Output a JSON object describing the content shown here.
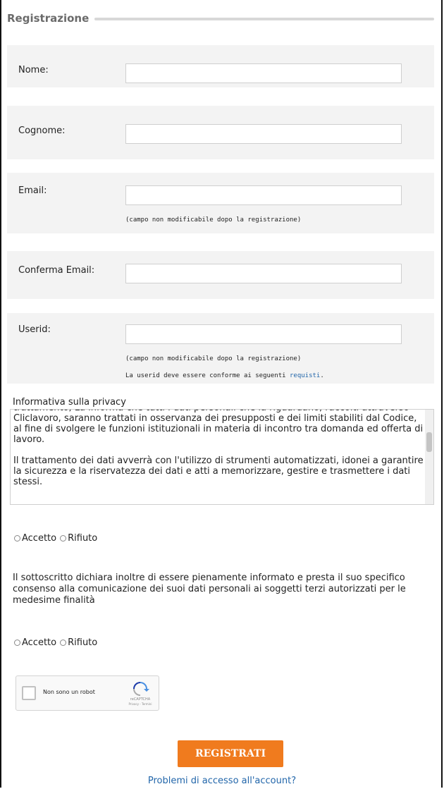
{
  "form": {
    "legend": "Registrazione",
    "fields": {
      "nome": {
        "label": "Nome:",
        "value": ""
      },
      "cognome": {
        "label": "Cognome:",
        "value": ""
      },
      "email": {
        "label": "Email:",
        "value": "",
        "hint": "(campo non modificabile dopo la registrazione)"
      },
      "conferma_email": {
        "label": "Conferma Email:",
        "value": ""
      },
      "userid": {
        "label": "Userid:",
        "value": "",
        "hint": "(campo non modificabile dopo la registrazione)",
        "rule_prefix": "La userid deve essere conforme ai seguenti ",
        "rule_link": "requisti",
        "rule_suffix": "."
      }
    }
  },
  "privacy": {
    "title": "Informativa sulla privacy",
    "paragraph1": "trattamento, La informa che tutti i dati personali che la riguardano, raccolti attraverso Cliclavoro, saranno trattati in osservanza dei presupposti e dei limiti stabiliti dal Codice, al fine di svolgere le funzioni istituzionali in materia di incontro tra domanda ed offerta di lavoro.",
    "paragraph2": "Il trattamento dei dati avverrà con l'utilizzo di strumenti automatizzati, idonei a garantire la sicurezza e la riservatezza dei dati e atti a memorizzare, gestire e trasmettere i dati stessi.",
    "accept_label": "Accetto",
    "reject_label": "Rifiuto"
  },
  "consent": {
    "text": "Il sottoscritto dichiara inoltre di essere pienamente informato e presta il suo specifico consenso alla comunicazione dei suoi dati personali ai soggetti terzi autorizzati per le medesime finalità",
    "accept_label": "Accetto",
    "reject_label": "Rifiuto"
  },
  "recaptcha": {
    "label": "Non sono un robot",
    "brand": "reCAPTCHA",
    "terms": "Privacy - Termini"
  },
  "actions": {
    "submit_label": "REGISTRATI",
    "help_link": "Problemi di accesso all'account?"
  },
  "colors": {
    "accent": "#f07b1e",
    "link": "#2266aa",
    "row_bg": "#f3f3f3"
  }
}
